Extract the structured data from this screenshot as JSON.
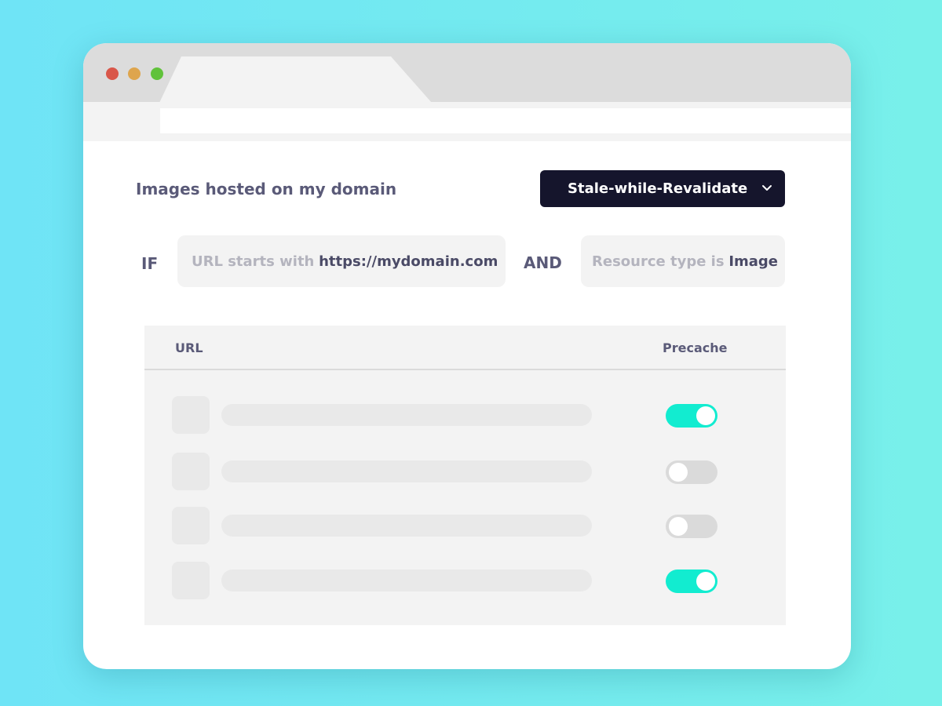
{
  "rule": {
    "title": "Images hosted on my domain",
    "strategy_label": "Stale-while-Revalidate",
    "if_label": "IF",
    "and_label": "AND",
    "condition_url": {
      "prefix": "URL starts with",
      "value": "https://mydomain.com"
    },
    "condition_type": {
      "prefix": "Resource type is",
      "value": "Image"
    }
  },
  "table": {
    "headers": {
      "url": "URL",
      "precache": "Precache"
    },
    "rows": [
      {
        "precache": true
      },
      {
        "precache": false
      },
      {
        "precache": false
      },
      {
        "precache": true
      }
    ]
  },
  "colors": {
    "accent": "#12ecd0",
    "dropdown_bg": "#15152c",
    "text_dark": "#5a5a78"
  },
  "icons": [
    "chevron-down-icon"
  ]
}
